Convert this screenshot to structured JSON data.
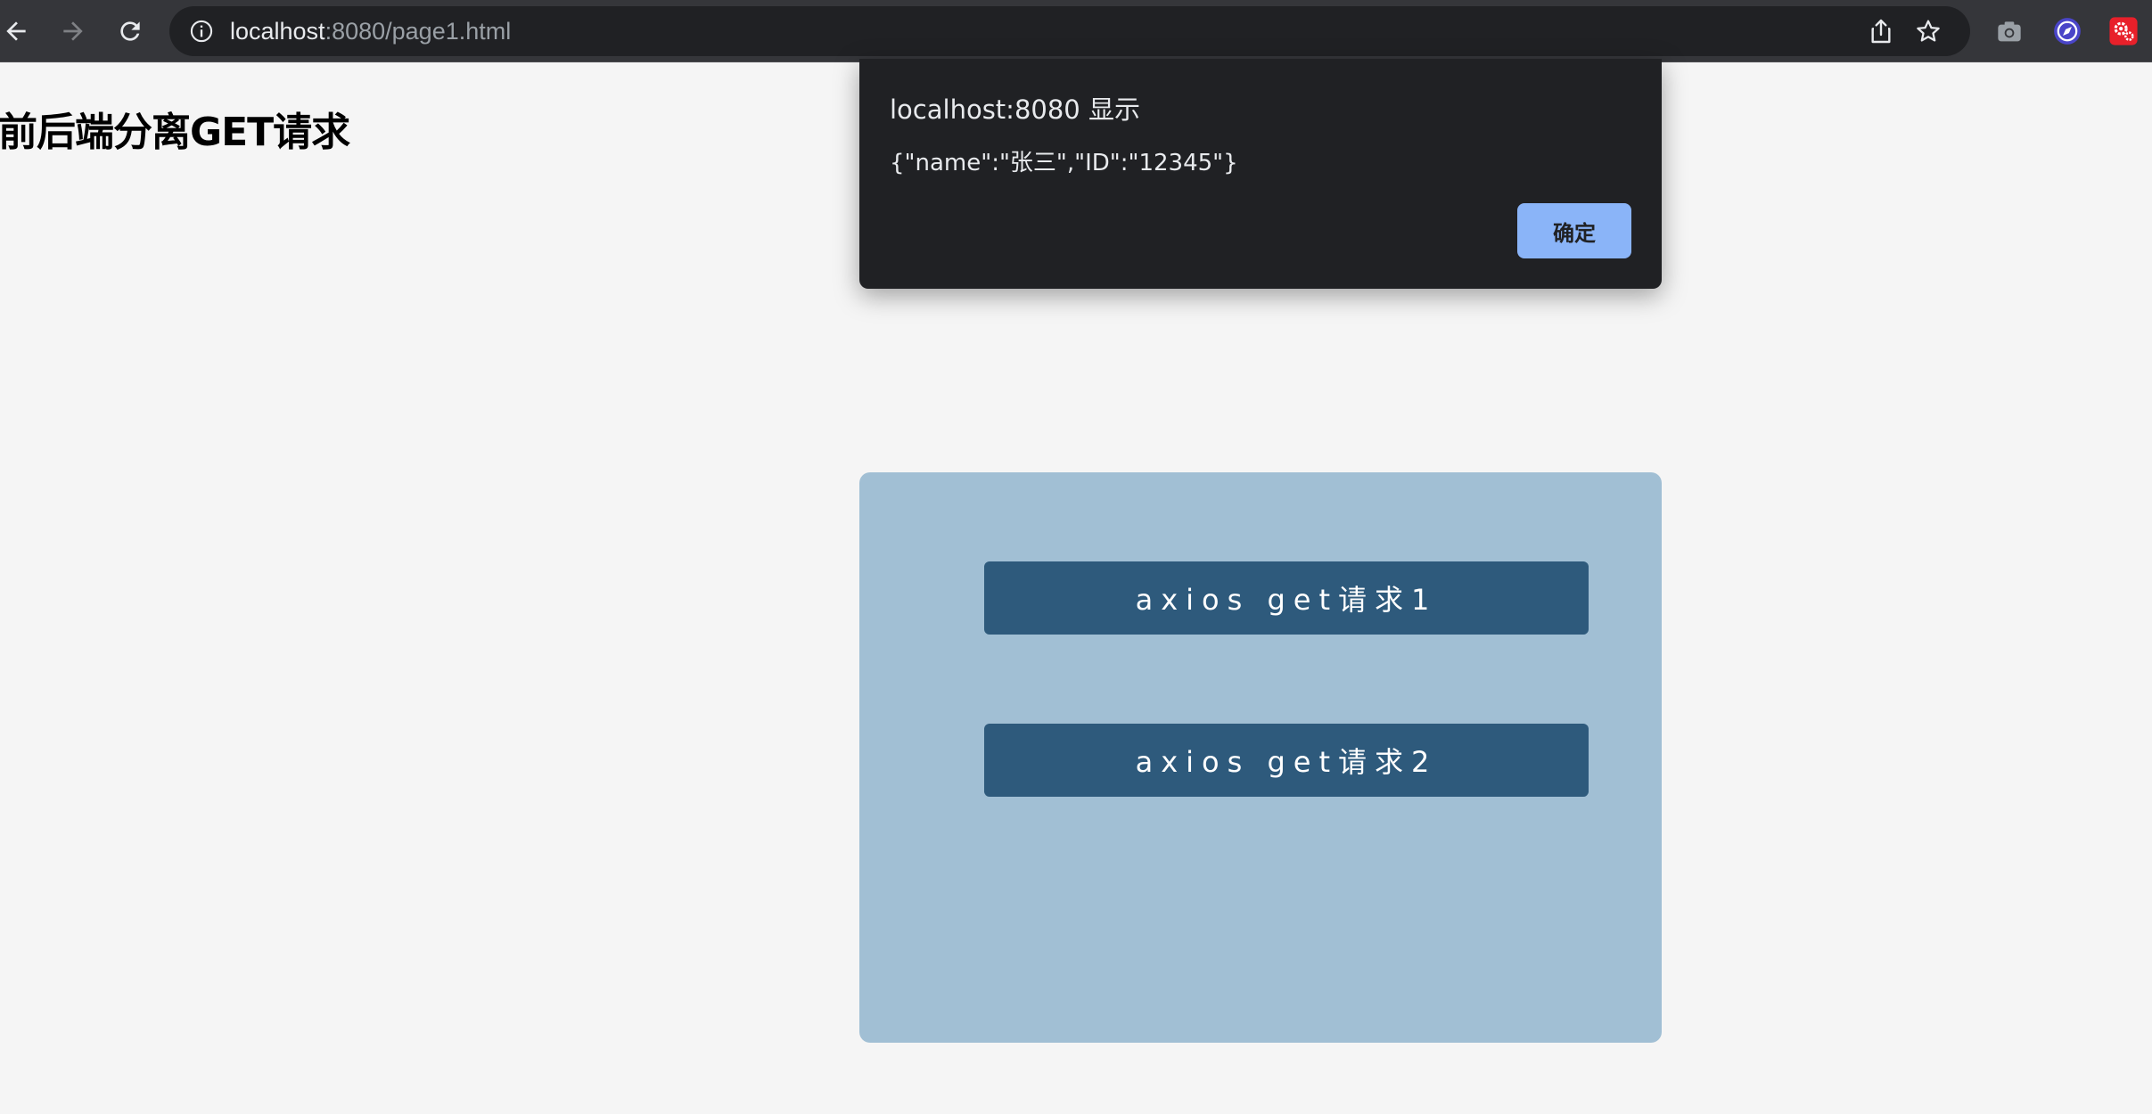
{
  "browser": {
    "url_host": "localhost",
    "url_path": ":8080/page1.html",
    "icons": {
      "back": "back-arrow-icon",
      "forward": "forward-arrow-icon",
      "reload": "reload-icon",
      "info": "info-icon",
      "share": "share-icon",
      "bookmark": "star-icon",
      "extensions": [
        "camera-icon",
        "compass-icon",
        "settings-gear-icon"
      ]
    },
    "colors": {
      "toolbar": "#35363a",
      "omnibox": "#202124"
    }
  },
  "page": {
    "heading": "前后端分离GET请求",
    "buttons": [
      {
        "label": "axios get请求1"
      },
      {
        "label": "axios get请求2"
      }
    ],
    "colors": {
      "background": "#f5f5f5",
      "panel": "#a1bfd4",
      "button": "#2e5a7c"
    }
  },
  "dialog": {
    "title": "localhost:8080 显示",
    "message": "{\"name\":\"张三\",\"ID\":\"12345\"}",
    "ok_label": "确定",
    "colors": {
      "background": "#202124",
      "ok_button": "#8ab4f8"
    }
  }
}
